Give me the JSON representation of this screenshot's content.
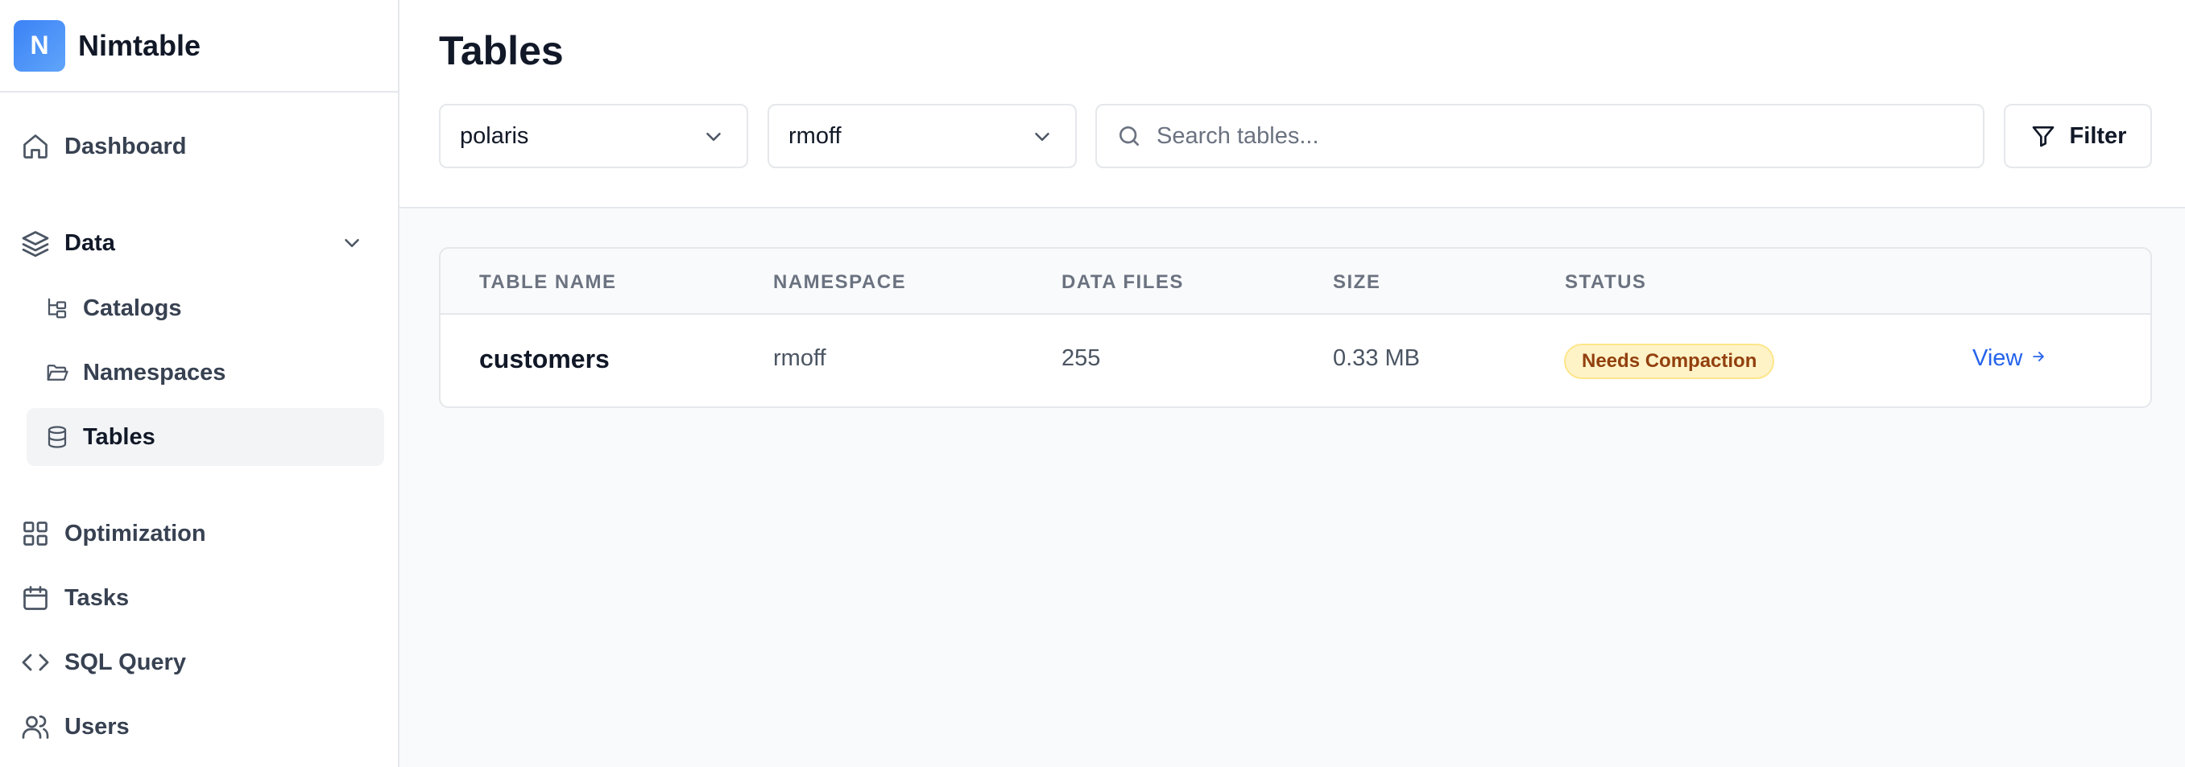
{
  "app": {
    "logo_letter": "N",
    "name": "Nimtable"
  },
  "sidebar": {
    "dashboard": "Dashboard",
    "data": "Data",
    "catalogs": "Catalogs",
    "namespaces": "Namespaces",
    "tables": "Tables",
    "optimization": "Optimization",
    "tasks": "Tasks",
    "sql_query": "SQL Query",
    "users": "Users",
    "active_item": "Tables"
  },
  "header": {
    "title": "Tables",
    "catalog_select": "polaris",
    "namespace_select": "rmoff",
    "search_placeholder": "Search tables...",
    "filter_label": "Filter"
  },
  "table": {
    "columns": [
      "TABLE NAME",
      "NAMESPACE",
      "DATA FILES",
      "SIZE",
      "STATUS"
    ],
    "rows": [
      {
        "name": "customers",
        "namespace": "rmoff",
        "data_files": "255",
        "size": "0.33 MB",
        "status": "Needs Compaction",
        "action": "View"
      }
    ]
  },
  "colors": {
    "accent": "#2563eb",
    "badge_bg": "#fef3c7",
    "badge_text": "#92400e"
  }
}
